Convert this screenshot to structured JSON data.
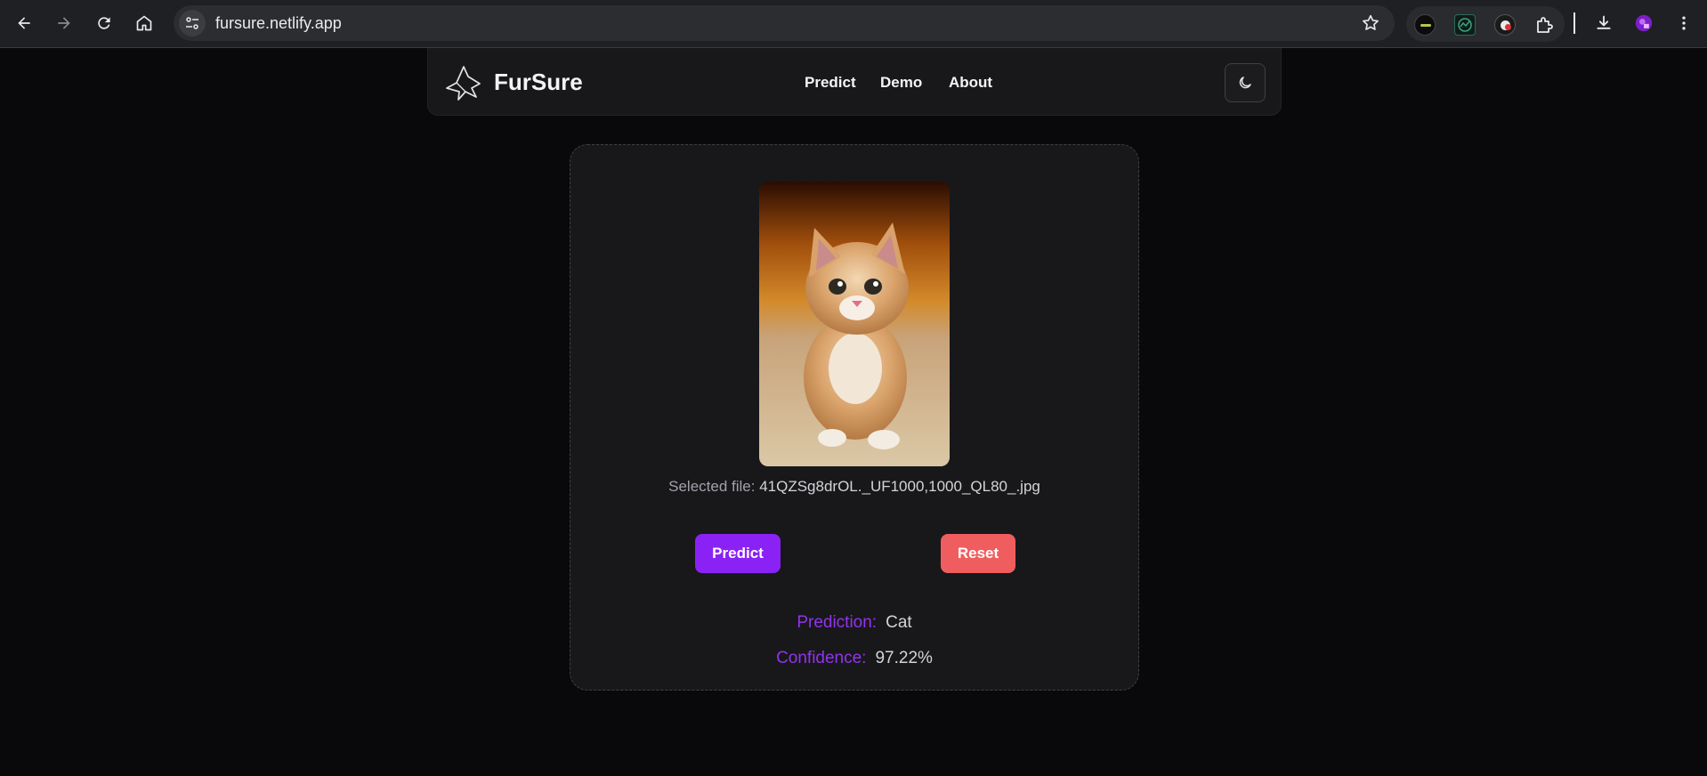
{
  "browser": {
    "url": "fursure.netlify.app"
  },
  "brand": {
    "name": "FurSure"
  },
  "nav": {
    "links": [
      "Predict",
      "Demo",
      "About"
    ]
  },
  "upload": {
    "selected_label": "Selected file:",
    "filename": "41QZSg8drOL._UF1000,1000_QL80_.jpg"
  },
  "actions": {
    "predict_label": "Predict",
    "reset_label": "Reset"
  },
  "result": {
    "prediction_label": "Prediction:",
    "prediction_value": "Cat",
    "confidence_label": "Confidence:",
    "confidence_value": "97.22%"
  },
  "colors": {
    "accent": "#8b22f5",
    "reset": "#f05d5e",
    "label": "#9333ea",
    "background": "#09090b",
    "card": "#18181b"
  }
}
